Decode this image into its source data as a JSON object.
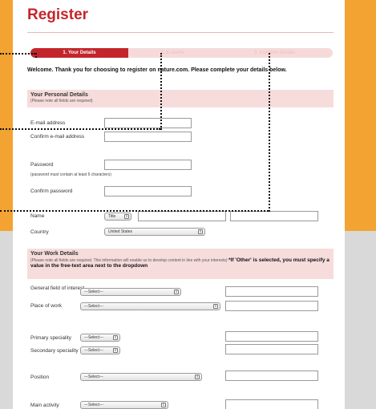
{
  "page": {
    "title": "Register"
  },
  "progress": {
    "steps": [
      {
        "label": "1. Your Details",
        "active": true
      },
      {
        "label": "2. E-alerts",
        "active": false
      },
      {
        "label": "3. Confirm Details",
        "active": false
      }
    ]
  },
  "welcome": "Welcome. Thank you for choosing to register on nature.com. Please complete your details below.",
  "personal": {
    "title": "Your Personal Details",
    "note": "(Please note all fields are required)",
    "email_label": "E-mail address",
    "confirm_email_label": "Confirm e-mail address",
    "password_label": "Password",
    "password_note": "(password must contain at least 6 characters)",
    "confirm_password_label": "Confirm password",
    "name_label": "Name",
    "title_select": "Title",
    "country_label": "Country",
    "country_value": "United States"
  },
  "work": {
    "title": "Your Work Details",
    "note": "(Please note all fields are required. This information will enable us to develop content in line with your interests)",
    "note_bold": "*If 'Other' is selected, you must specify a value in the free-text area next to the dropdown",
    "general_field_label": "General field of interest",
    "place_label": "Place of work",
    "primary_label": "Primary speciality",
    "secondary_label": "Secondary speciality",
    "position_label": "Position",
    "main_activity_label": "Main activity",
    "select_placeholder": "---Select---"
  },
  "colors": {
    "brand_red": "#c4252c",
    "orange": "#f2a332",
    "pink": "#f7dcdc"
  }
}
